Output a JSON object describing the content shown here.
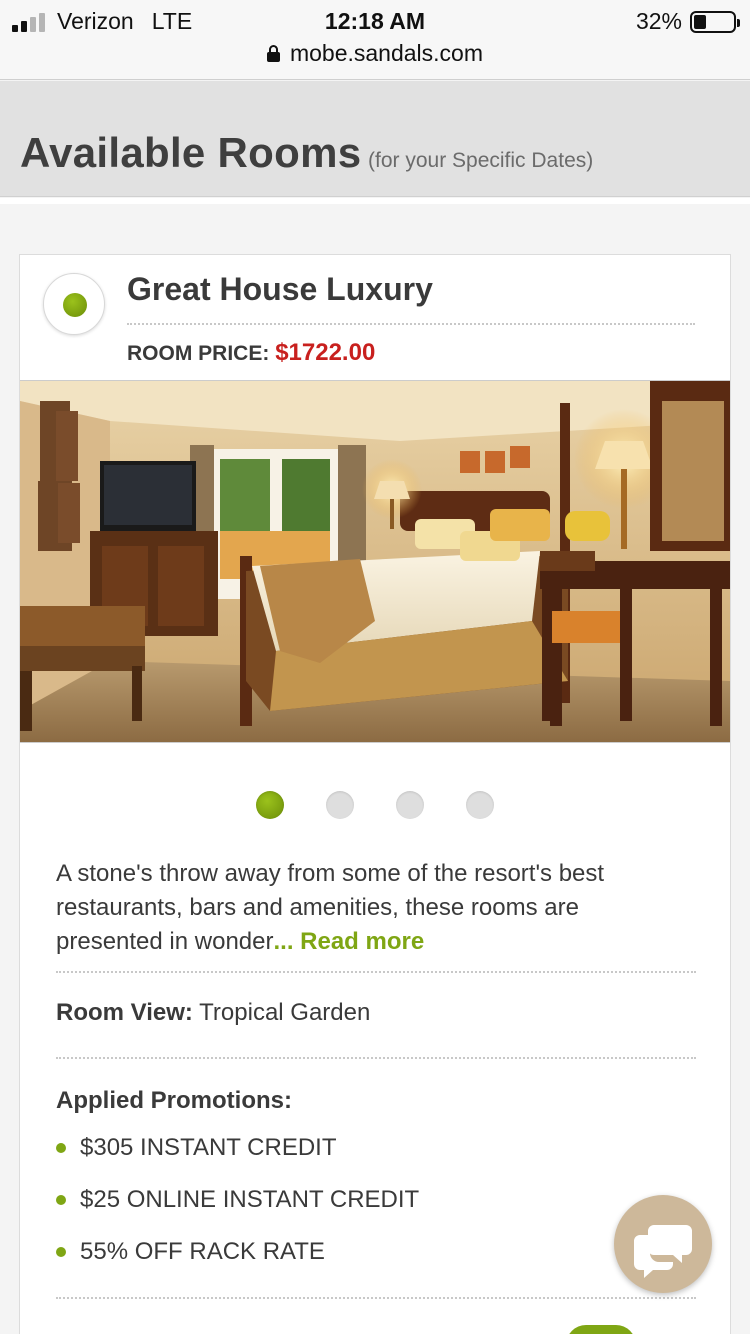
{
  "status_bar": {
    "carrier": "Verizon",
    "network": "LTE",
    "time": "12:18 AM",
    "battery": "32%",
    "battery_level": 0.32
  },
  "browser": {
    "url": "mobe.sandals.com"
  },
  "header": {
    "title": "Available Rooms",
    "subtitle": "(for your Specific Dates)"
  },
  "room": {
    "name": "Great House Luxury",
    "price_label": "ROOM PRICE:",
    "price": "$1722.00",
    "photo_pager": {
      "count": 4,
      "active_index": 0
    },
    "description": "A stone's throw away from some of the resort's best restaurants, bars and amenities, these rooms are presented in wonder",
    "read_more": "... Read more",
    "view_label": "Room View:",
    "view_value": "Tropical Garden",
    "promotions_title": "Applied Promotions:",
    "promotions": [
      "$305 INSTANT CREDIT",
      "$25 ONLINE INSTANT CREDIT",
      "55% OFF RACK RATE"
    ]
  },
  "icons": {
    "chat": "chat-bubbles-icon",
    "lock": "lock-icon",
    "signal": "signal-icon",
    "battery": "battery-icon"
  },
  "colors": {
    "accent_green": "#7fa614",
    "price_red": "#c8201e",
    "chat_fab": "#cdb89a"
  }
}
